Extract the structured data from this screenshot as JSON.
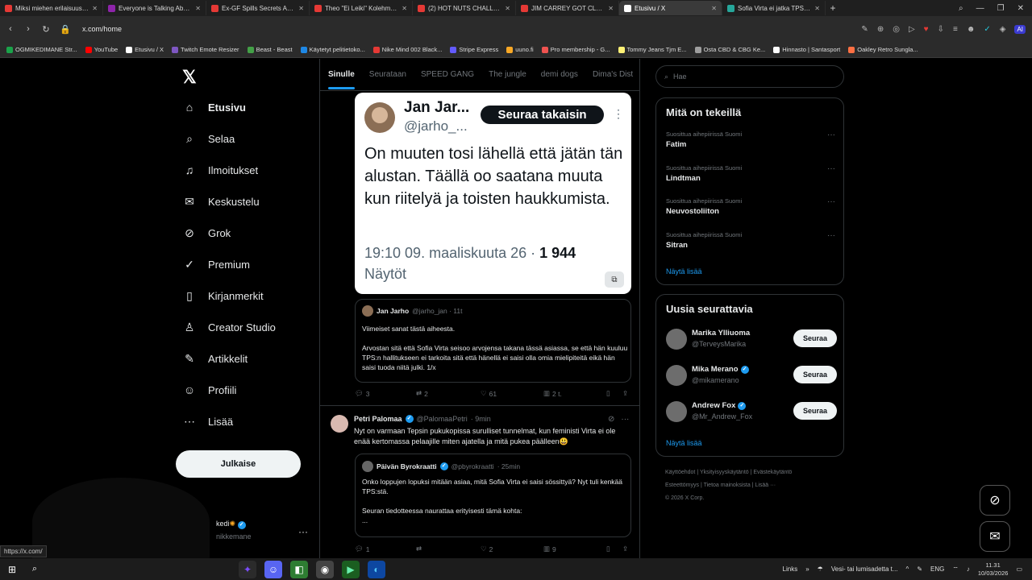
{
  "browser": {
    "tabs": [
      {
        "title": "Miksi miehen erilaisuus ko",
        "color": "#e53935",
        "active": false
      },
      {
        "title": "Everyone is Talking About",
        "color": "#8e24aa",
        "active": false
      },
      {
        "title": "Ex-GF Spills Secrets About",
        "color": "#e53935",
        "active": false
      },
      {
        "title": "Theo \"Ei Leiki\" Kolehmain",
        "color": "#e53935",
        "active": false
      },
      {
        "title": "(2) HOT NUTS CHALLENG",
        "color": "#e53935",
        "active": false
      },
      {
        "title": "JIM CARREY GOT CLONED",
        "color": "#e53935",
        "active": false
      },
      {
        "title": "Etusivu / X",
        "color": "#ffffff",
        "active": true
      },
      {
        "title": "Sofia Virta ei jatka TPSn h",
        "color": "#26a69a",
        "active": false
      }
    ],
    "url": "x.com/home",
    "bookmarks": [
      {
        "label": "OGMIKEDIMANE Str...",
        "color": "#1aa34a"
      },
      {
        "label": "YouTube",
        "color": "#ff0000"
      },
      {
        "label": "Etusivu / X",
        "color": "#ffffff"
      },
      {
        "label": "Twitch Emote Resizer",
        "color": "#7e57c2"
      },
      {
        "label": "Beast - Beast",
        "color": "#43a047"
      },
      {
        "label": "Käytetyt pelitietoko...",
        "color": "#1e88e5"
      },
      {
        "label": "Nike Mind 002 Black...",
        "color": "#e53935"
      },
      {
        "label": "Stripe Express",
        "color": "#635bff"
      },
      {
        "label": "uuno.fi",
        "color": "#f9a825"
      },
      {
        "label": "Pro membership - G...",
        "color": "#ef5350"
      },
      {
        "label": "Tommy Jeans Tjm E...",
        "color": "#fff176"
      },
      {
        "label": "Osta CBD & CBG Ke...",
        "color": "#9e9e9e"
      },
      {
        "label": "Hinnasto | Santasport",
        "color": "#ffffff"
      },
      {
        "label": "Oakley Retro Sungla...",
        "color": "#ff7043"
      }
    ]
  },
  "nav": {
    "items": [
      {
        "label": "Etusivu",
        "icon": "home-icon",
        "glyph": "⌂"
      },
      {
        "label": "Selaa",
        "icon": "search-icon",
        "glyph": "⌕"
      },
      {
        "label": "Ilmoitukset",
        "icon": "bell-icon",
        "glyph": "♫"
      },
      {
        "label": "Keskustelu",
        "icon": "mail-icon",
        "glyph": "✉"
      },
      {
        "label": "Grok",
        "icon": "grok-icon",
        "glyph": "⊘"
      },
      {
        "label": "Premium",
        "icon": "premium-icon",
        "glyph": "✓"
      },
      {
        "label": "Kirjanmerkit",
        "icon": "bookmark-icon",
        "glyph": "▯"
      },
      {
        "label": "Creator Studio",
        "icon": "creator-icon",
        "glyph": "♙"
      },
      {
        "label": "Artikkelit",
        "icon": "article-icon",
        "glyph": "✎"
      },
      {
        "label": "Profiili",
        "icon": "profile-icon",
        "glyph": "☺"
      },
      {
        "label": "Lisää",
        "icon": "more-icon",
        "glyph": "⋯"
      }
    ],
    "post_button": "Julkaise",
    "account_name": "kedi",
    "account_handle": "nikkemane"
  },
  "feed_tabs": [
    "Sinulle",
    "Seurataan",
    "SPEED GANG",
    "The jungle",
    "demi dogs",
    "Dima's Dist"
  ],
  "screenshot_card": {
    "name": "Jan Jar...",
    "handle": "@jarho_...",
    "follow_back": "Seuraa takaisin",
    "text": "On muuten tosi lähellä että jätän tän alustan. Täällä oo saatana muuta kun riitelyä ja toisten haukkumista.",
    "meta_time": "19:10 09. maaliskuuta 26 · ",
    "meta_views": "1 944",
    "meta_views_label": "Näytöt"
  },
  "quoted_post": {
    "name": "Jan Jarho",
    "handle": "@jarho_jan · 11t",
    "text": "Viimeiset sanat tästä aiheesta.\n\nArvostan sitä että Sofia Virta seisoo arvojensa takana tässä asiassa, se että hän kuuluu TPS:n hallitukseen ei tarkoita sitä että hänellä ei saisi olla omia mielipiteitä eikä hän saisi tuoda niitä julki. 1/x"
  },
  "post1_actions": {
    "replies": "3",
    "reposts": "2",
    "likes": "61",
    "views": "2 t."
  },
  "post2": {
    "name": "Petri Palomaa",
    "handle": "@PalomaaPetri",
    "time": "· 9min",
    "text": "Nyt on varmaan Tepsin pukukopissa surulliset tunnelmat, kun feministi Virta ei ole enää kertomassa pelaajille miten ajatella ja mitä pukea päälleen😃",
    "quote_name": "Päivän Byrokraatti",
    "quote_handle": "@pbyrokraatti",
    "quote_time": "· 25min",
    "quote_text": "Onko loppujen lopuksi mitään asiaa, mitä Sofia Virta ei saisi sössittyä? Nyt tuli kenkää TPS:stä.\n\nSeuran tiedotteessa naurattaa erityisesti tämä kohta:\n..."
  },
  "post2_actions": {
    "replies": "1",
    "reposts": "",
    "likes": "2",
    "views": "9"
  },
  "right": {
    "search_placeholder": "Hae",
    "trends_title": "Mitä on tekeillä",
    "trends": [
      {
        "context": "Suosittua aihepiirissä Suomi",
        "name": "Fatim"
      },
      {
        "context": "Suosittua aihepiirissä Suomi",
        "name": "Lindtman"
      },
      {
        "context": "Suosittua aihepiirissä Suomi",
        "name": "Neuvostoliiton"
      },
      {
        "context": "Suosittua aihepiirissä Suomi",
        "name": "Sitran"
      }
    ],
    "show_more": "Näytä lisää",
    "who_title": "Uusia seurattavia",
    "who": [
      {
        "name": "Marika Ylliuoma",
        "handle": "@TerveysMarika",
        "verified": false
      },
      {
        "name": "Mika Merano",
        "handle": "@mikamerano",
        "verified": true
      },
      {
        "name": "Andrew Fox",
        "handle": "@Mr_Andrew_Fox",
        "verified": true
      }
    ],
    "follow_label": "Seuraa",
    "footer_links": [
      "Käyttöehdot",
      "Yksityisyyskäytäntö",
      "Evästekäytäntö",
      "Esteettömyys",
      "Tietoa mainoksista",
      "Lisää ···"
    ],
    "copyright": "© 2026 X Corp."
  },
  "status_url": "https://x.com/",
  "taskbar": {
    "links": "Links",
    "weather": "Vesi- tai lumisadetta t...",
    "lang": "ENG",
    "time": "11.31",
    "date": "10/03/2026"
  }
}
